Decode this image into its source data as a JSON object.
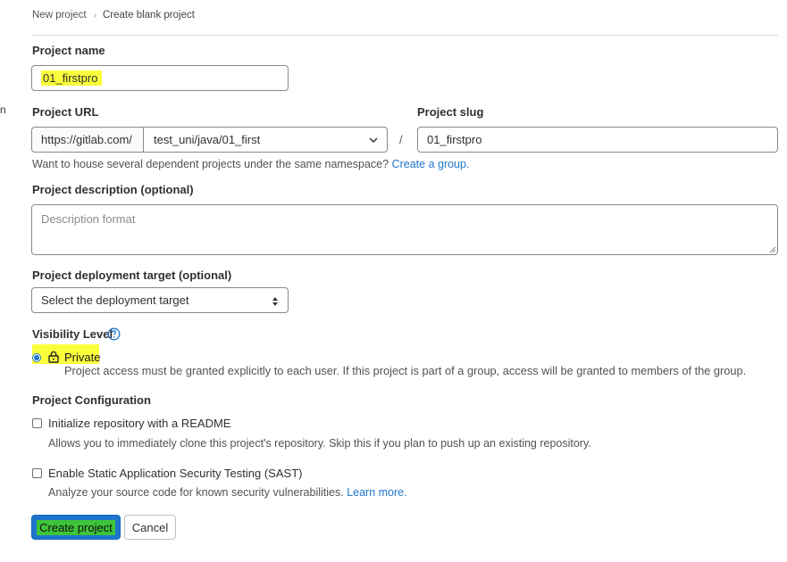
{
  "breadcrumb": {
    "items": [
      "New project",
      "Create blank project"
    ],
    "separator": "›"
  },
  "edge_fragment": "n",
  "project_name": {
    "label": "Project name",
    "value": "01_firstpro"
  },
  "project_url": {
    "label": "Project URL",
    "prefix": "https://gitlab.com/",
    "namespace": "test_uni/java/01_first",
    "slash": "/"
  },
  "project_slug": {
    "label": "Project slug",
    "value": "01_firstpro"
  },
  "namespace_help": {
    "text": "Want to house several dependent projects under the same namespace?",
    "link": "Create a group."
  },
  "description": {
    "label": "Project description (optional)",
    "placeholder": "Description format"
  },
  "deployment": {
    "label": "Project deployment target (optional)",
    "selected": "Select the deployment target"
  },
  "visibility": {
    "label": "Visibility Level",
    "option_label": "Private",
    "option_help": "Project access must be granted explicitly to each user. If this project is part of a group, access will be granted to members of the group."
  },
  "configuration": {
    "label": "Project Configuration",
    "readme": {
      "label": "Initialize repository with a README",
      "help": "Allows you to immediately clone this project's repository. Skip this if you plan to push up an existing repository."
    },
    "sast": {
      "label": "Enable Static Application Security Testing (SAST)",
      "help": "Analyze your source code for known security vulnerabilities.",
      "link": "Learn more."
    }
  },
  "actions": {
    "create": "Create project",
    "cancel": "Cancel"
  },
  "colors": {
    "primary": "#1f75cb",
    "highlight_yellow": "#fbff3b",
    "highlight_green": "#3ec43a"
  },
  "icons": {
    "breadcrumb_separator": "chevron-right-icon",
    "select_arrow": "chevron-down-icon",
    "deployment_arrow": "sort-arrows-icon",
    "help": "question-circle-icon",
    "lock": "lock-icon"
  }
}
